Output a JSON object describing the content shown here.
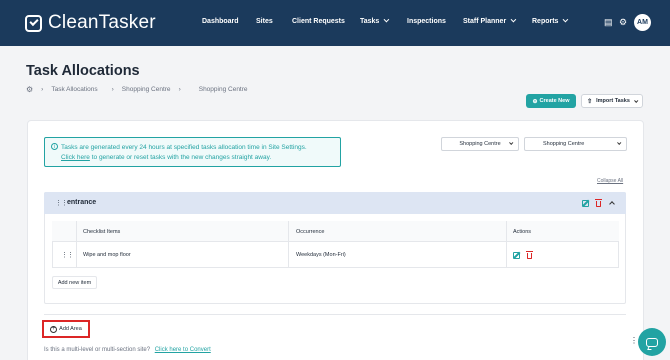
{
  "brand": {
    "name": "CleanTasker"
  },
  "nav": {
    "items": [
      {
        "label": "Dashboard",
        "dropdown": false
      },
      {
        "label": "Sites",
        "dropdown": false
      },
      {
        "label": "Client Requests",
        "dropdown": false
      },
      {
        "label": "Tasks",
        "dropdown": true
      },
      {
        "label": "Inspections",
        "dropdown": false
      },
      {
        "label": "Staff Planner",
        "dropdown": true
      },
      {
        "label": "Reports",
        "dropdown": true
      }
    ],
    "user_initials": "AM"
  },
  "page": {
    "title": "Task Allocations",
    "breadcrumb": [
      "Task Allocations",
      "Shopping Centre",
      "Shopping Centre"
    ]
  },
  "actions": {
    "create_new": "Create New",
    "import_tasks": "Import Tasks"
  },
  "info_banner": {
    "text": "Tasks are generated every 24 hours at specified tasks allocation time in Site Settings.",
    "link_text": "Click here",
    "link_suffix": "to generate or reset tasks with the new changes straight away."
  },
  "filters": {
    "site": "Shopping Centre",
    "section": "Shopping Centre"
  },
  "collapse_all": "Collapse All",
  "area": {
    "name": "entrance",
    "table": {
      "headers": [
        "Checklist Items",
        "Occurrence",
        "Actions"
      ],
      "rows": [
        {
          "item": "Wipe and mop floor",
          "occurrence": "Weekdays (Mon-Fri)"
        }
      ]
    },
    "add_item": "Add new item"
  },
  "add_area": "Add Area",
  "multi_level": {
    "question": "Is this a multi-level or multi-section site?",
    "link": "Click here to Convert"
  },
  "colors": {
    "header_bg": "#1b3a5c",
    "accent": "#22a3a3",
    "danger": "#dc2626",
    "area_header_bg": "#dde5f3"
  }
}
